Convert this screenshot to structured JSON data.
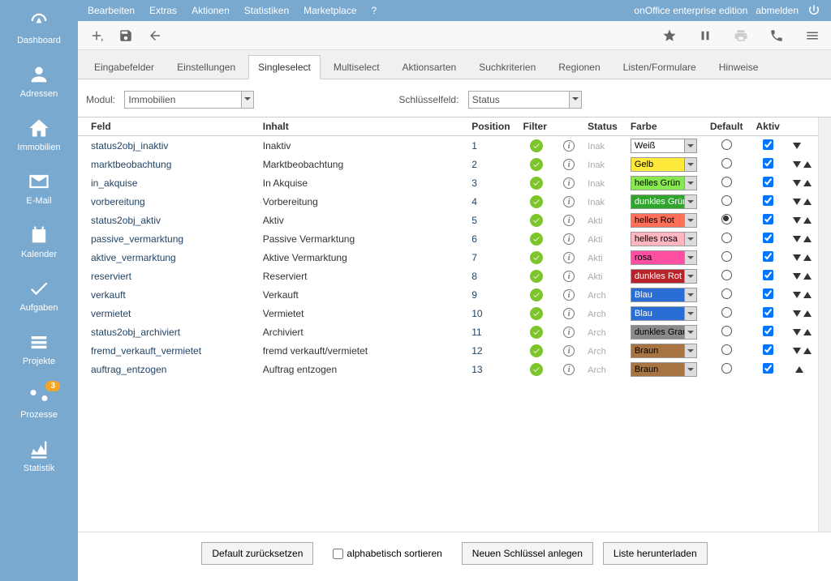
{
  "header": {
    "menu": [
      "Bearbeiten",
      "Extras",
      "Aktionen",
      "Statistiken",
      "Marketplace",
      "?"
    ],
    "edition": "onOffice enterprise edition",
    "logout": "abmelden"
  },
  "sidebar": [
    {
      "label": "Dashboard",
      "icon": "gauge"
    },
    {
      "label": "Adressen",
      "icon": "user"
    },
    {
      "label": "Immobilien",
      "icon": "home"
    },
    {
      "label": "E-Mail",
      "icon": "mail"
    },
    {
      "label": "Kalender",
      "icon": "calendar"
    },
    {
      "label": "Aufgaben",
      "icon": "check"
    },
    {
      "label": "Projekte",
      "icon": "stack"
    },
    {
      "label": "Prozesse",
      "icon": "flow",
      "badge": "3"
    },
    {
      "label": "Statistik",
      "icon": "chart"
    }
  ],
  "tabs": [
    "Eingabefelder",
    "Einstellungen",
    "Singleselect",
    "Multiselect",
    "Aktionsarten",
    "Suchkriterien",
    "Regionen",
    "Listen/Formulare",
    "Hinweise"
  ],
  "active_tab": 2,
  "filters": {
    "modul_label": "Modul:",
    "modul_value": "Immobilien",
    "key_label": "Schlüsselfeld:",
    "key_value": "Status"
  },
  "columns": {
    "feld": "Feld",
    "inhalt": "Inhalt",
    "position": "Position",
    "filter": "Filter",
    "status": "Status",
    "farbe": "Farbe",
    "default": "Default",
    "aktiv": "Aktiv"
  },
  "color_palette": {
    "Weiß": "#ffffff",
    "Gelb": "#ffe93b",
    "helles Grün": "#87e850",
    "dunkles Grün": "#2fa62b",
    "helles Rot": "#ff6f5a",
    "helles rosa": "#ffb6c1",
    "rosa": "#ff4fa2",
    "dunkles Rot": "#b8222a",
    "Blau": "#2a6dd4",
    "dunkles Grau": "#8a8a8a",
    "Braun": "#a87442"
  },
  "rows": [
    {
      "feld": "status2obj_inaktiv",
      "inhalt": "Inaktiv",
      "pos": "1",
      "status": "Inaktiv",
      "color": "Weiß",
      "default": false,
      "down": true,
      "up": false
    },
    {
      "feld": "marktbeobachtung",
      "inhalt": "Marktbeobachtung",
      "pos": "2",
      "status": "Inaktiv",
      "color": "Gelb",
      "default": false,
      "down": true,
      "up": true
    },
    {
      "feld": "in_akquise",
      "inhalt": "In Akquise",
      "pos": "3",
      "status": "Inaktiv",
      "color": "helles Grün",
      "default": false,
      "down": true,
      "up": true
    },
    {
      "feld": "vorbereitung",
      "inhalt": "Vorbereitung",
      "pos": "4",
      "status": "Inaktiv",
      "color": "dunkles Grün",
      "default": false,
      "down": true,
      "up": true
    },
    {
      "feld": "status2obj_aktiv",
      "inhalt": "Aktiv",
      "pos": "5",
      "status": "Aktiv",
      "color": "helles Rot",
      "default": true,
      "down": true,
      "up": true
    },
    {
      "feld": "passive_vermarktung",
      "inhalt": "Passive Vermarktung",
      "pos": "6",
      "status": "Aktiv",
      "color": "helles rosa",
      "default": false,
      "down": true,
      "up": true
    },
    {
      "feld": "aktive_vermarktung",
      "inhalt": "Aktive Vermarktung",
      "pos": "7",
      "status": "Aktiv",
      "color": "rosa",
      "default": false,
      "down": true,
      "up": true
    },
    {
      "feld": "reserviert",
      "inhalt": "Reserviert",
      "pos": "8",
      "status": "Aktiv",
      "color": "dunkles Rot",
      "default": false,
      "down": true,
      "up": true
    },
    {
      "feld": "verkauft",
      "inhalt": "Verkauft",
      "pos": "9",
      "status": "Archiv",
      "color": "Blau",
      "default": false,
      "down": true,
      "up": true
    },
    {
      "feld": "vermietet",
      "inhalt": "Vermietet",
      "pos": "10",
      "status": "Archiv",
      "color": "Blau",
      "default": false,
      "down": true,
      "up": true
    },
    {
      "feld": "status2obj_archiviert",
      "inhalt": "Archiviert",
      "pos": "11",
      "status": "Archiv",
      "color": "dunkles Grau",
      "default": false,
      "down": true,
      "up": true
    },
    {
      "feld": "fremd_verkauft_vermietet",
      "inhalt": "fremd verkauft/vermietet",
      "pos": "12",
      "status": "Archiv",
      "color": "Braun",
      "default": false,
      "down": true,
      "up": true
    },
    {
      "feld": "auftrag_entzogen",
      "inhalt": "Auftrag entzogen",
      "pos": "13",
      "status": "Archiv",
      "color": "Braun",
      "default": false,
      "down": false,
      "up": true
    }
  ],
  "footer": {
    "reset": "Default zurücksetzen",
    "alpha": "alphabetisch sortieren",
    "newkey": "Neuen Schlüssel anlegen",
    "download": "Liste herunterladen"
  }
}
